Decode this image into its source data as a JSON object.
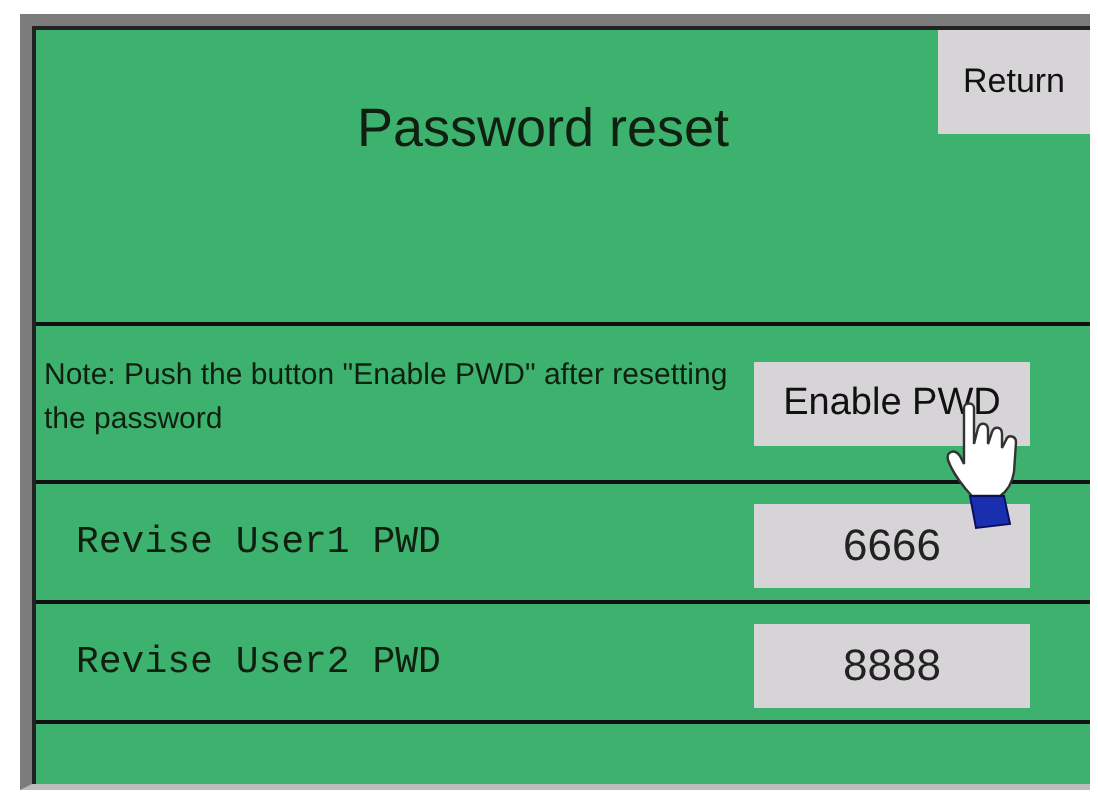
{
  "title": "Password reset",
  "return_button": "Return",
  "note": "Note: Push the button \"Enable PWD\" after resetting the password",
  "enable_button": "Enable PWD",
  "rows": [
    {
      "label": "Revise User1 PWD",
      "value": "6666"
    },
    {
      "label": "Revise User2 PWD",
      "value": "8888"
    }
  ]
}
